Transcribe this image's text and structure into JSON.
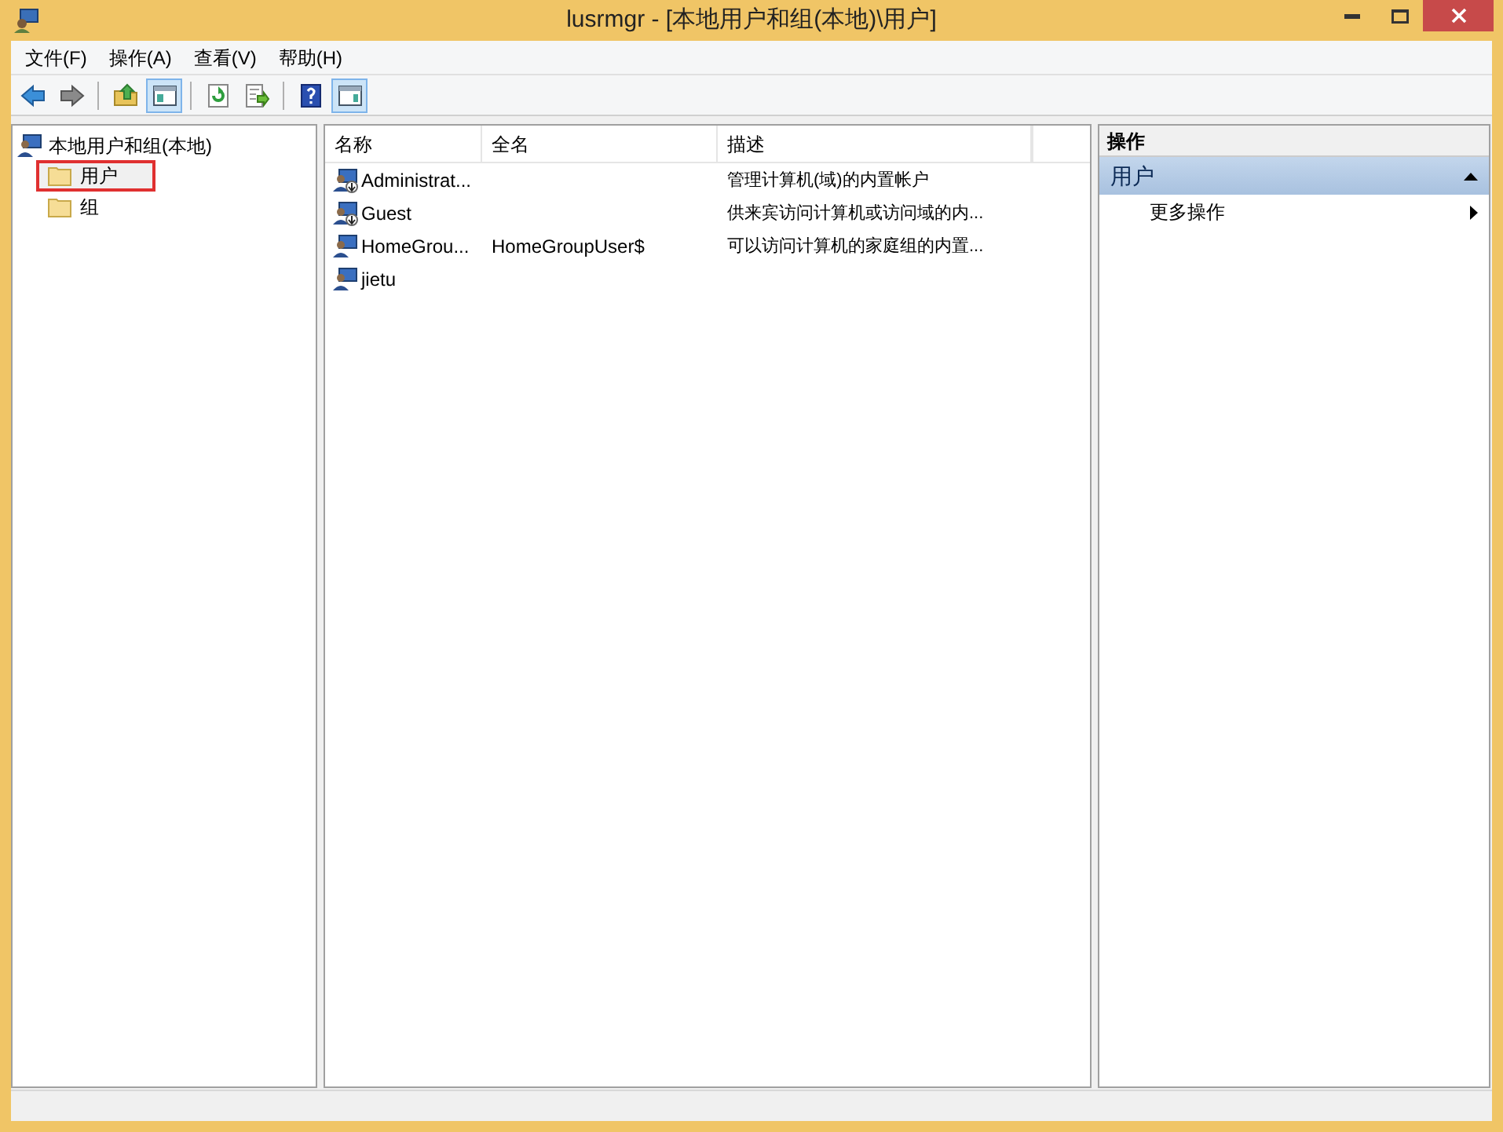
{
  "window": {
    "title": "lusrmgr - [本地用户和组(本地)\\用户]"
  },
  "menu": [
    "文件(F)",
    "操作(A)",
    "查看(V)",
    "帮助(H)"
  ],
  "toolbar": [
    {
      "kind": "back",
      "pressed": false
    },
    {
      "kind": "forward",
      "pressed": false
    },
    {
      "kind": "up",
      "pressed": false
    },
    {
      "kind": "tree",
      "pressed": true
    },
    {
      "kind": "refresh",
      "pressed": false
    },
    {
      "kind": "export",
      "pressed": false
    },
    {
      "kind": "help",
      "pressed": false
    },
    {
      "kind": "actionpane",
      "pressed": true
    }
  ],
  "tree": {
    "label": "本地用户和组(本地)",
    "children": [
      {
        "label": "用户",
        "selected": true,
        "highlighted": true
      },
      {
        "label": "组",
        "selected": false,
        "highlighted": false
      }
    ]
  },
  "table": {
    "columns": [
      "名称",
      "全名",
      "描述"
    ],
    "rows": [
      {
        "kind": "builtin",
        "name": "Administrat...",
        "full_name": "",
        "description": "管理计算机(域)的内置帐户"
      },
      {
        "kind": "builtin",
        "name": "Guest",
        "full_name": "",
        "description": "供来宾访问计算机或访问域的内..."
      },
      {
        "kind": "user",
        "name": "HomeGrou...",
        "full_name": "HomeGroupUser$",
        "description": "可以访问计算机的家庭组的内置..."
      },
      {
        "kind": "user",
        "name": "jietu",
        "full_name": "",
        "description": ""
      }
    ]
  },
  "actions": {
    "title": "操作",
    "section": {
      "label": "用户",
      "expanded": true,
      "items": [
        {
          "label": "更多操作",
          "submenu": true
        }
      ]
    }
  }
}
